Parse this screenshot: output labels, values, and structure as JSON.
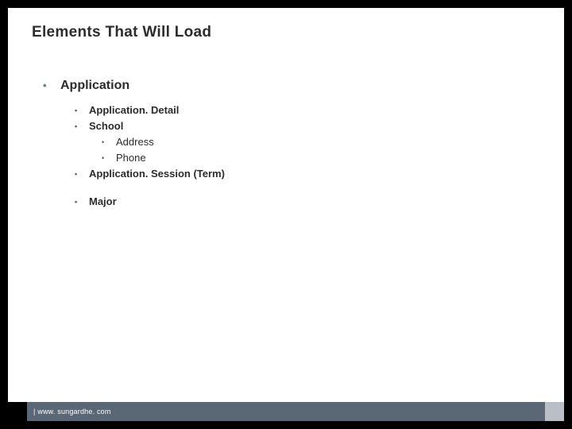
{
  "slide": {
    "title": "Elements That Will Load",
    "bullets": {
      "lvl1": "Application",
      "lvl2_detail": "Application. Detail",
      "lvl2_school": "School",
      "lvl3_address": "Address",
      "lvl3_phone": "Phone",
      "lvl2_session": "Application. Session  (Term)",
      "lvl2_major": "Major"
    },
    "footer": "| www. sungardhe. com"
  }
}
